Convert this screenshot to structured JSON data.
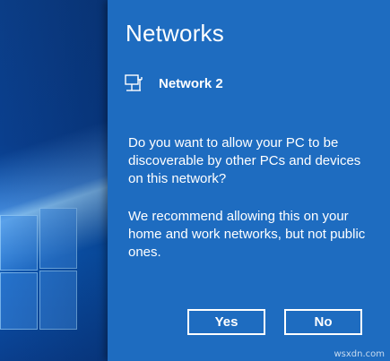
{
  "flyout": {
    "title": "Networks",
    "network": {
      "icon": "wired-network-icon",
      "name": "Network 2"
    },
    "question": "Do you want to allow your PC to be discoverable by other PCs and devices on this network?",
    "recommendation": "We recommend allowing this on your home and work networks, but not public ones.",
    "buttons": {
      "yes_label": "Yes",
      "no_label": "No"
    }
  },
  "watermark": "wsxdn.com",
  "colors": {
    "flyout_background": "#1e6cc0",
    "text": "#ffffff",
    "wallpaper": "#0b3d86"
  }
}
